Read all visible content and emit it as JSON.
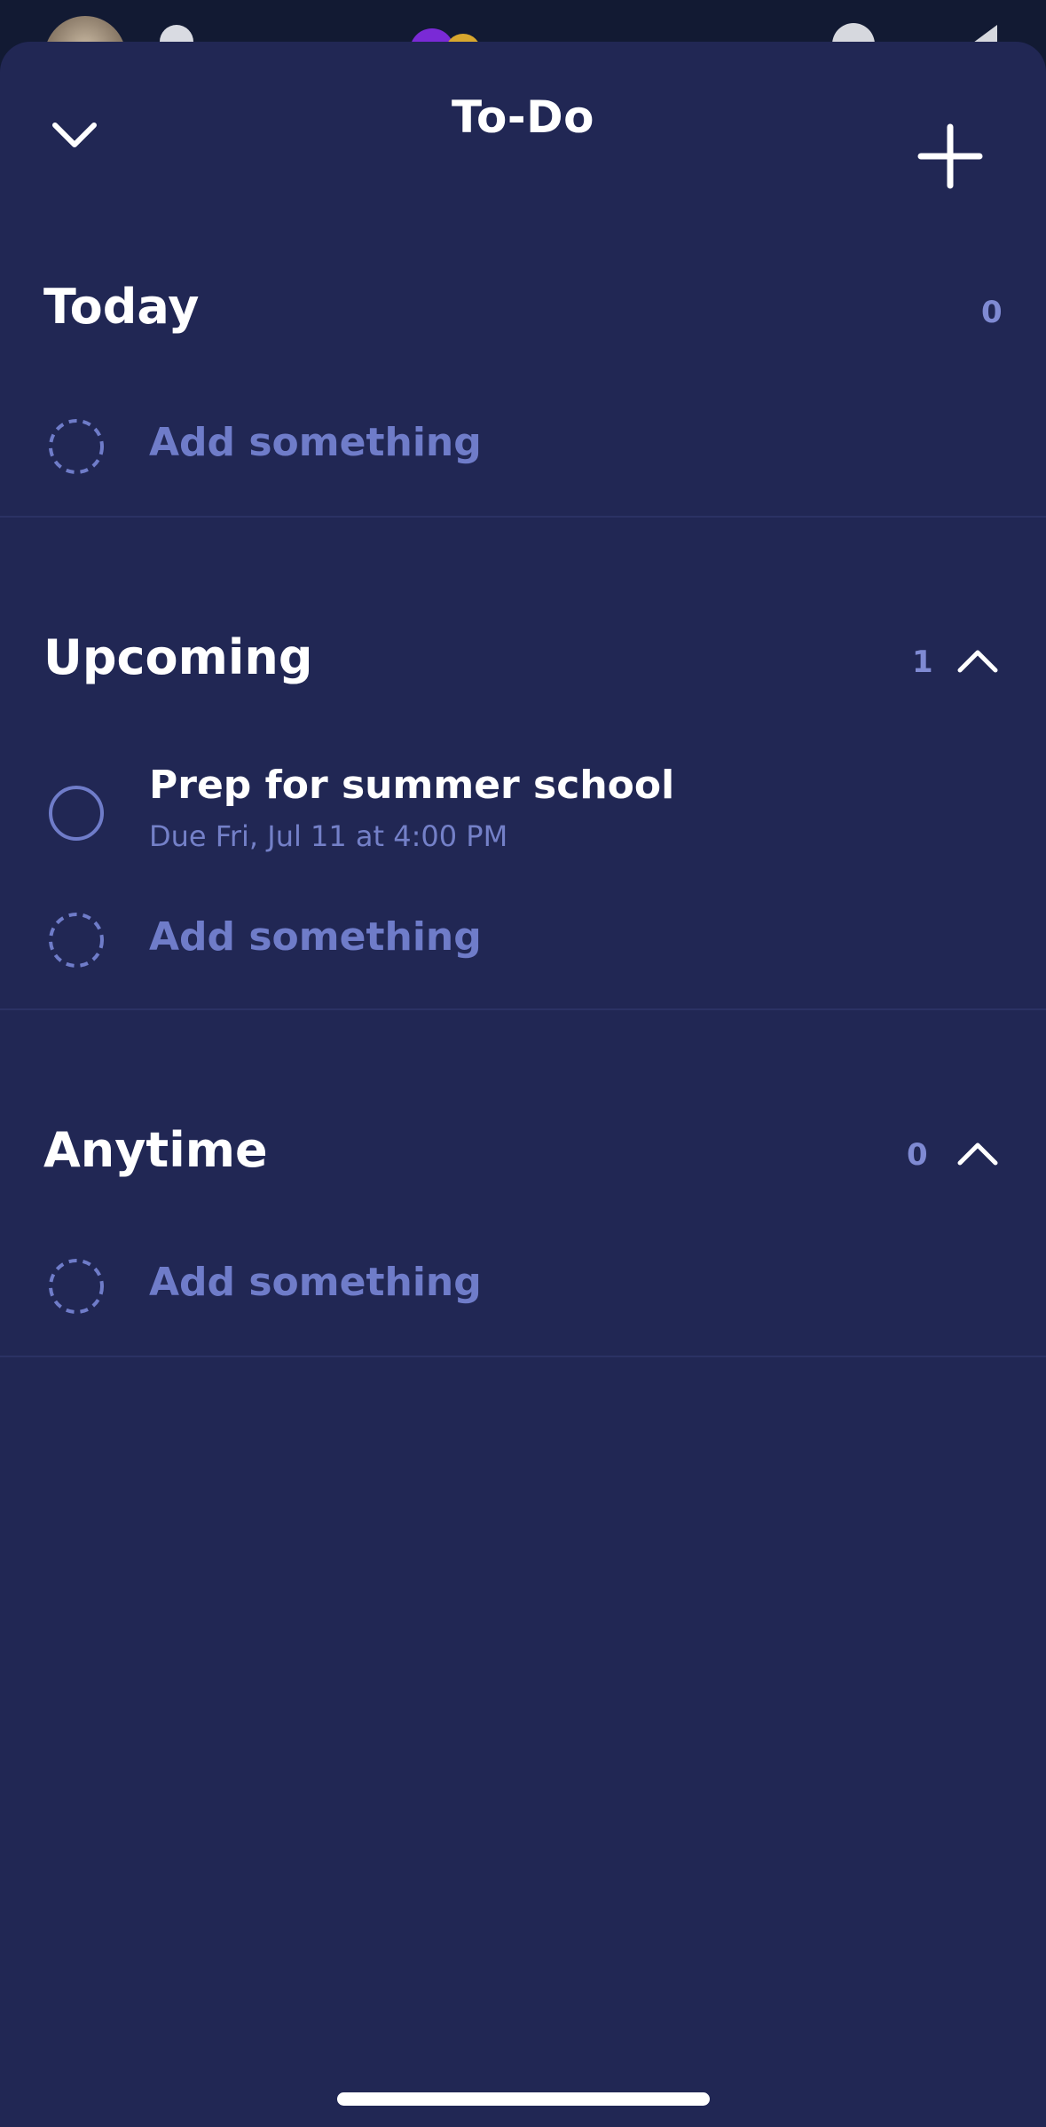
{
  "header": {
    "title": "To-Do"
  },
  "sections": [
    {
      "title": "Today",
      "count": "0",
      "add_label": "Add something"
    },
    {
      "title": "Upcoming",
      "count": "1",
      "tasks": [
        {
          "title": "Prep for summer school",
          "due": "Due Fri, Jul 11 at 4:00 PM"
        }
      ],
      "add_label": "Add something"
    },
    {
      "title": "Anytime",
      "count": "0",
      "add_label": "Add something"
    }
  ],
  "colors": {
    "sheet_bg": "#212754",
    "accent_muted": "#6f7cc9",
    "text_primary": "#ffffff"
  }
}
